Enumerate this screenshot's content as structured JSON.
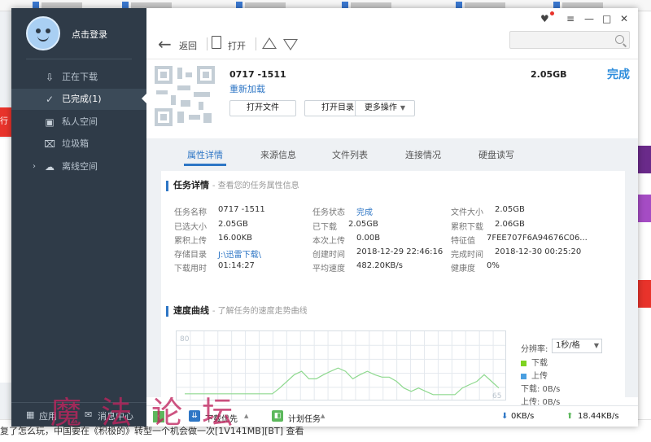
{
  "sidebar": {
    "login_label": "点击登录",
    "items": [
      {
        "label": "正在下载",
        "icon": "download-icon"
      },
      {
        "label": "已完成(1)",
        "icon": "check-circle-icon"
      },
      {
        "label": "私人空间",
        "icon": "lock-icon"
      },
      {
        "label": "垃圾箱",
        "icon": "trash-icon"
      },
      {
        "label": "离线空间",
        "icon": "cloud-icon"
      }
    ],
    "bottom": {
      "apps_label": "应用",
      "messages_label": "消息中心"
    }
  },
  "toolbar": {
    "back_label": "返回",
    "open_label": "打开",
    "search_placeholder": ""
  },
  "task": {
    "name": "0717 -1511",
    "reload_label": "重新加载",
    "size": "2.05GB",
    "status": "完成",
    "buttons": {
      "open_file": "打开文件",
      "open_dir": "打开目录",
      "more": "更多操作"
    }
  },
  "tabs": [
    "属性详情",
    "来源信息",
    "文件列表",
    "连接情况",
    "硬盘读写"
  ],
  "properties": {
    "title": "任务详情",
    "subtitle": "- 查看您的任务属性信息",
    "rows": [
      [
        [
          "任务名称",
          "0717 -1511"
        ],
        [
          "任务状态",
          "完成"
        ],
        [
          "文件大小",
          "2.05GB"
        ]
      ],
      [
        [
          "已选大小",
          "2.05GB"
        ],
        [
          "已下载",
          "2.05GB"
        ],
        [
          "累积下载",
          "2.06GB"
        ]
      ],
      [
        [
          "累积上传",
          "16.00KB"
        ],
        [
          "本次上传",
          "0.00B"
        ],
        [
          "特征值",
          "7FEE707F6A94676C06..."
        ]
      ],
      [
        [
          "存储目录",
          "J:\\迅雷下载\\"
        ],
        [
          "创建时间",
          "2018-12-29 22:46:16"
        ],
        [
          "完成时间",
          "2018-12-30 00:25:20"
        ]
      ],
      [
        [
          "下载用时",
          "01:14:27"
        ],
        [
          "平均速度",
          "482.20KB/s"
        ],
        [
          "健康度",
          "0%"
        ]
      ]
    ]
  },
  "speed_curve": {
    "title": "速度曲线",
    "subtitle": "- 了解任务的速度走势曲线",
    "rate_label": "分辨率:",
    "rate_value": "1秒/格",
    "legend": [
      {
        "label": "下载",
        "color": "#7ed321"
      },
      {
        "label": "上传",
        "color": "#4a9fe0"
      }
    ],
    "download_speed": "下载:  0B/s",
    "upload_speed": "上传:  0B/s"
  },
  "chart_data": {
    "type": "line",
    "y_tick_labels": [
      "80",
      "65"
    ],
    "series": [
      {
        "name": "下载",
        "color": "#8fd98f",
        "values": [
          7,
          7,
          7,
          7,
          7,
          7,
          7,
          7,
          7,
          7,
          7,
          7,
          7,
          14,
          22,
          30,
          34,
          25,
          25,
          30,
          34,
          38,
          34,
          25,
          30,
          34,
          30,
          27,
          27,
          22,
          14,
          10,
          14,
          10,
          6,
          6,
          6,
          6,
          14,
          18,
          22,
          30,
          22,
          14
        ]
      }
    ]
  },
  "statusbar": {
    "priority_label": "下载优先",
    "plan_label": "计划任务",
    "down_speed": "0KB/s",
    "up_speed": "18.44KB/s"
  },
  "background": {
    "bottom_text": "复了怎么玩，中国要在《积极的》转型一个机会做一次[1V141MB][BT]   查看",
    "watermark": "魔 法 论 坛",
    "left_red_text": "行价"
  }
}
